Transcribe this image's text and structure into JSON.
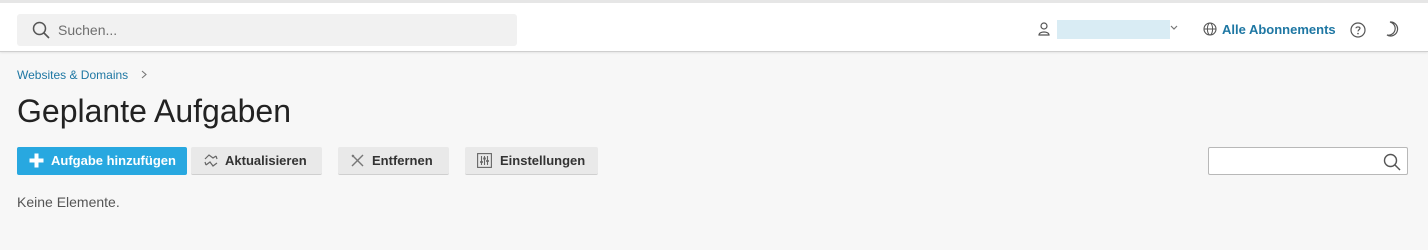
{
  "header": {
    "search_placeholder": "Suchen...",
    "subscriptions_link": "Alle Abonnements",
    "icons": [
      "search-icon",
      "user-icon",
      "chevron-down-icon",
      "globe-icon",
      "help-icon",
      "moon-icon"
    ]
  },
  "breadcrumb": {
    "item": "Websites & Domains"
  },
  "page": {
    "title": "Geplante Aufgaben"
  },
  "toolbar": {
    "add_label": "Aufgabe hinzufügen",
    "refresh_label": "Aktualisieren",
    "remove_label": "Entfernen",
    "settings_label": "Einstellungen"
  },
  "list": {
    "empty_message": "Keine Elemente."
  },
  "colors": {
    "accent": "#28a8e0",
    "link": "#1e77a3"
  }
}
